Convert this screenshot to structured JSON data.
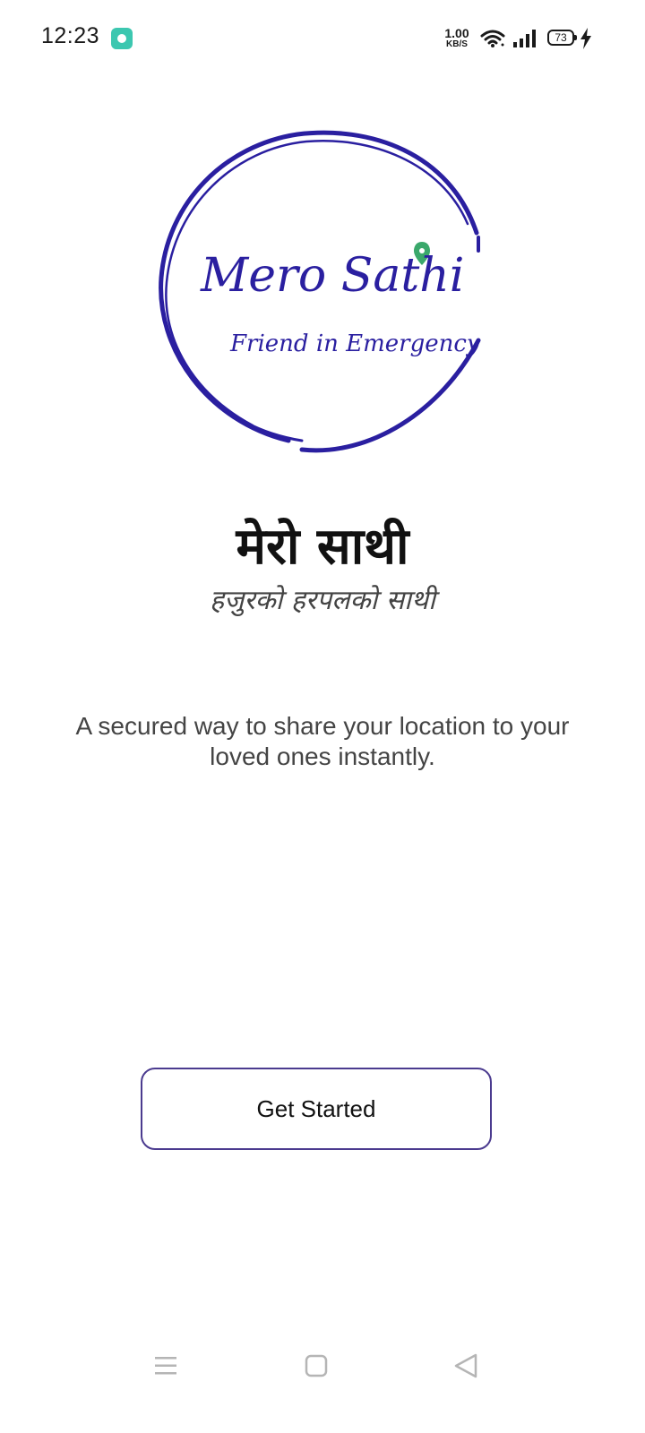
{
  "status_bar": {
    "time": "12:23",
    "net_speed_value": "1.00",
    "net_speed_unit": "KB/S",
    "battery_level": "73"
  },
  "logo": {
    "title": "Mero Sathi",
    "subtitle": "Friend in Emergency",
    "ring_color": "#2a1fa0",
    "pin_color": "#3aa86b"
  },
  "hero": {
    "title": "मेरो साथी",
    "tagline": "हजुरको  हरपलको साथी",
    "description": "A secured way to share your location to your loved ones instantly."
  },
  "actions": {
    "get_started_label": "Get Started"
  },
  "colors": {
    "accent": "#4b3b8f",
    "text_primary": "#111111",
    "text_secondary": "#444444"
  }
}
